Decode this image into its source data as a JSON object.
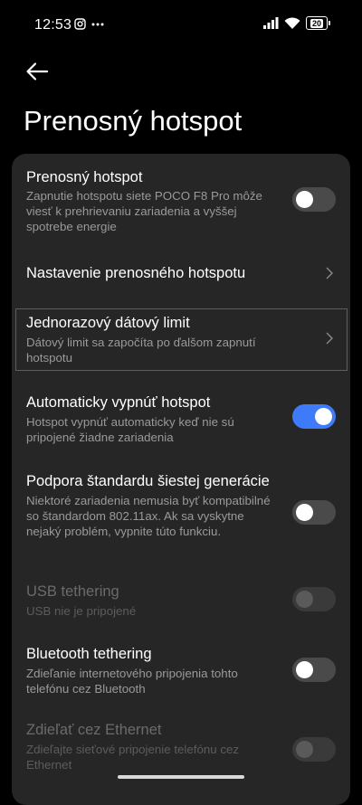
{
  "status_bar": {
    "time": "12:53",
    "battery_level": "20"
  },
  "header": {
    "title": "Prenosný hotspot"
  },
  "rows": [
    {
      "title": "Prenosný hotspot",
      "subtitle": "Zapnutie hotspotu siete POCO F8 Pro môže viesť k prehrievaniu zariadenia a vyššej spotrebe energie",
      "control": "toggle",
      "enabled": false
    },
    {
      "title": "Nastavenie prenosného hotspotu",
      "control": "chevron"
    },
    {
      "title": "Jednorazový dátový limit",
      "subtitle": "Dátový limit sa započíta po ďalšom zapnutí hotspotu",
      "control": "chevron"
    },
    {
      "title": "Automaticky vypnúť hotspot",
      "subtitle": "Hotspot vypnúť automaticky keď nie sú pripojené žiadne zariadenia",
      "control": "toggle",
      "enabled": true
    },
    {
      "title": "Podpora štandardu šiestej generácie",
      "subtitle": "Niektoré zariadenia nemusia byť kompatibilné so štandardom 802.11ax. Ak sa vyskytne nejaký problém, vypnite túto funkciu.",
      "control": "toggle",
      "enabled": false
    },
    {
      "title": "USB tethering",
      "subtitle": "USB nie je pripojené",
      "control": "toggle",
      "enabled": false,
      "disabled": true
    },
    {
      "title": "Bluetooth tethering",
      "subtitle": "Zdieľanie internetového pripojenia tohto telefónu cez Bluetooth",
      "control": "toggle",
      "enabled": false
    },
    {
      "title": "Zdieľať cez Ethernet",
      "subtitle": "Zdieľajte sieťové pripojenie telefónu cez Ethernet",
      "control": "toggle",
      "enabled": false,
      "disabled": true
    }
  ],
  "colors": {
    "background": "#000000",
    "card": "#262626",
    "accent": "#3e7bfa",
    "highlight": "#e0262b"
  }
}
